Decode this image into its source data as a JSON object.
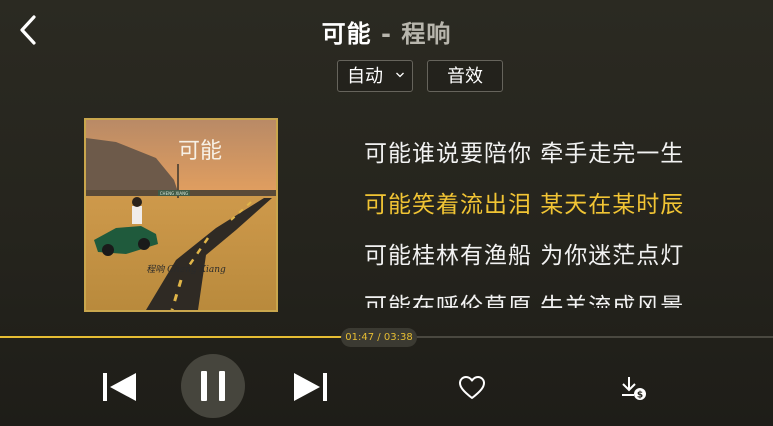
{
  "header": {
    "song_title": "可能",
    "separator": "-",
    "artist": "程响"
  },
  "toolbar": {
    "mode_label": "自动",
    "effect_label": "音效"
  },
  "album": {
    "cover_text": "可能",
    "road_sign_text": "CHENG XIANG",
    "signature_text": "程响 Cheng Xiang"
  },
  "lyrics": {
    "lines": [
      "可能谁说要陪你 牵手走完一生",
      "可能笑着流出泪 某天在某时辰",
      "可能桂林有渔船 为你迷茫点灯",
      "可能在呼伦草原 牛羊流成风景"
    ],
    "active_index": 1
  },
  "player": {
    "elapsed": "01:47",
    "duration": "03:38",
    "time_separator": " / ",
    "progress": 0.491
  },
  "icons": {
    "back": "chevron-left-icon",
    "prev": "skip-previous-icon",
    "pause": "pause-icon",
    "next": "skip-next-icon",
    "favorite": "heart-icon",
    "download": "download-icon"
  },
  "colors": {
    "accent": "#f1c434",
    "background": "#2b2a22",
    "control_circle": "#46453d"
  }
}
